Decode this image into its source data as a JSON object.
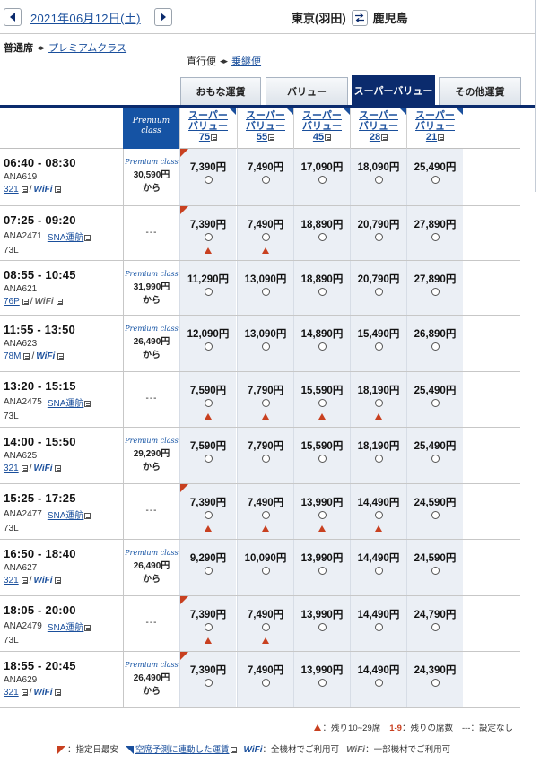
{
  "header": {
    "date": "2021年06月12日(土)",
    "origin": "東京(羽田)",
    "destination": "鹿児島"
  },
  "class_selector": {
    "current": "普通席",
    "other": "プレミアムクラス"
  },
  "direction_selector": {
    "current": "直行便",
    "other": "乗継便"
  },
  "tabs": [
    {
      "label": "おもな運賃",
      "active": false
    },
    {
      "label": "バリュー",
      "active": false
    },
    {
      "label": "スーパーバリュー",
      "active": true
    },
    {
      "label": "その他運賃",
      "active": false
    }
  ],
  "premium_header": "Premium class",
  "fare_columns": [
    {
      "line1": "スーパー",
      "line2": "バリュー",
      "days": "75"
    },
    {
      "line1": "スーパー",
      "line2": "バリュー",
      "days": "55"
    },
    {
      "line1": "スーパー",
      "line2": "バリュー",
      "days": "45"
    },
    {
      "line1": "スーパー",
      "line2": "バリュー",
      "days": "28"
    },
    {
      "line1": "スーパー",
      "line2": "バリュー",
      "days": "21"
    }
  ],
  "flights": [
    {
      "time": "06:40 - 08:30",
      "flight_no": "ANA619",
      "operator": "",
      "aircraft": "321",
      "aircraft_plain": "",
      "wifi": "WiFi",
      "premium_logo": "Premium class",
      "premium_price": "30,590円",
      "premium_from": "から",
      "fares": [
        {
          "price": "7,390円",
          "flag": true,
          "tri": false
        },
        {
          "price": "7,490円",
          "flag": false,
          "tri": false
        },
        {
          "price": "17,090円",
          "flag": false,
          "tri": false
        },
        {
          "price": "18,090円",
          "flag": false,
          "tri": false
        },
        {
          "price": "25,490円",
          "flag": false,
          "tri": false
        }
      ]
    },
    {
      "time": "07:25 - 09:20",
      "flight_no": "ANA2471",
      "operator": "SNA運航",
      "aircraft": "",
      "aircraft_plain": "73L",
      "wifi": "",
      "premium_logo": "",
      "premium_price": "",
      "premium_from": "",
      "dash": "---",
      "fares": [
        {
          "price": "7,390円",
          "flag": true,
          "tri": true
        },
        {
          "price": "7,490円",
          "flag": false,
          "tri": true
        },
        {
          "price": "18,890円",
          "flag": false,
          "tri": false
        },
        {
          "price": "20,790円",
          "flag": false,
          "tri": false
        },
        {
          "price": "27,890円",
          "flag": false,
          "tri": false
        }
      ]
    },
    {
      "time": "08:55 - 10:45",
      "flight_no": "ANA621",
      "operator": "",
      "aircraft": "76P",
      "aircraft_plain": "",
      "wifi": "WiFi",
      "wifi_part": true,
      "premium_logo": "Premium class",
      "premium_price": "31,990円",
      "premium_from": "から",
      "fares": [
        {
          "price": "11,290円",
          "flag": false,
          "tri": false
        },
        {
          "price": "13,090円",
          "flag": false,
          "tri": false
        },
        {
          "price": "18,890円",
          "flag": false,
          "tri": false
        },
        {
          "price": "20,790円",
          "flag": false,
          "tri": false
        },
        {
          "price": "27,890円",
          "flag": false,
          "tri": false
        }
      ]
    },
    {
      "time": "11:55 - 13:50",
      "flight_no": "ANA623",
      "operator": "",
      "aircraft": "78M",
      "aircraft_plain": "",
      "wifi": "WiFi",
      "premium_logo": "Premium class",
      "premium_price": "26,490円",
      "premium_from": "から",
      "fares": [
        {
          "price": "12,090円",
          "flag": false,
          "tri": false
        },
        {
          "price": "13,090円",
          "flag": false,
          "tri": false
        },
        {
          "price": "14,890円",
          "flag": false,
          "tri": false
        },
        {
          "price": "15,490円",
          "flag": false,
          "tri": false
        },
        {
          "price": "26,890円",
          "flag": false,
          "tri": false
        }
      ]
    },
    {
      "time": "13:20 - 15:15",
      "flight_no": "ANA2475",
      "operator": "SNA運航",
      "aircraft": "",
      "aircraft_plain": "73L",
      "wifi": "",
      "premium_logo": "",
      "premium_price": "",
      "premium_from": "",
      "dash": "---",
      "fares": [
        {
          "price": "7,590円",
          "flag": false,
          "tri": true
        },
        {
          "price": "7,790円",
          "flag": false,
          "tri": true
        },
        {
          "price": "15,590円",
          "flag": false,
          "tri": true
        },
        {
          "price": "18,190円",
          "flag": false,
          "tri": true
        },
        {
          "price": "25,490円",
          "flag": false,
          "tri": false
        }
      ]
    },
    {
      "time": "14:00 - 15:50",
      "flight_no": "ANA625",
      "operator": "",
      "aircraft": "321",
      "aircraft_plain": "",
      "wifi": "WiFi",
      "premium_logo": "Premium class",
      "premium_price": "29,290円",
      "premium_from": "から",
      "fares": [
        {
          "price": "7,590円",
          "flag": false,
          "tri": false
        },
        {
          "price": "7,790円",
          "flag": false,
          "tri": false
        },
        {
          "price": "15,590円",
          "flag": false,
          "tri": false
        },
        {
          "price": "18,190円",
          "flag": false,
          "tri": false
        },
        {
          "price": "25,490円",
          "flag": false,
          "tri": false
        }
      ]
    },
    {
      "time": "15:25 - 17:25",
      "flight_no": "ANA2477",
      "operator": "SNA運航",
      "aircraft": "",
      "aircraft_plain": "73L",
      "wifi": "",
      "premium_logo": "",
      "premium_price": "",
      "premium_from": "",
      "dash": "---",
      "fares": [
        {
          "price": "7,390円",
          "flag": true,
          "tri": true
        },
        {
          "price": "7,490円",
          "flag": false,
          "tri": true
        },
        {
          "price": "13,990円",
          "flag": false,
          "tri": true
        },
        {
          "price": "14,490円",
          "flag": false,
          "tri": true
        },
        {
          "price": "24,590円",
          "flag": false,
          "tri": false
        }
      ]
    },
    {
      "time": "16:50 - 18:40",
      "flight_no": "ANA627",
      "operator": "",
      "aircraft": "321",
      "aircraft_plain": "",
      "wifi": "WiFi",
      "premium_logo": "Premium class",
      "premium_price": "26,490円",
      "premium_from": "から",
      "fares": [
        {
          "price": "9,290円",
          "flag": false,
          "tri": false
        },
        {
          "price": "10,090円",
          "flag": false,
          "tri": false
        },
        {
          "price": "13,990円",
          "flag": false,
          "tri": false
        },
        {
          "price": "14,490円",
          "flag": false,
          "tri": false
        },
        {
          "price": "24,590円",
          "flag": false,
          "tri": false
        }
      ]
    },
    {
      "time": "18:05 - 20:00",
      "flight_no": "ANA2479",
      "operator": "SNA運航",
      "aircraft": "",
      "aircraft_plain": "73L",
      "wifi": "",
      "premium_logo": "",
      "premium_price": "",
      "premium_from": "",
      "dash": "---",
      "fares": [
        {
          "price": "7,390円",
          "flag": true,
          "tri": true
        },
        {
          "price": "7,490円",
          "flag": false,
          "tri": true
        },
        {
          "price": "13,990円",
          "flag": false,
          "tri": false
        },
        {
          "price": "14,490円",
          "flag": false,
          "tri": false
        },
        {
          "price": "24,790円",
          "flag": false,
          "tri": false
        }
      ]
    },
    {
      "time": "18:55 - 20:45",
      "flight_no": "ANA629",
      "operator": "",
      "aircraft": "321",
      "aircraft_plain": "",
      "wifi": "WiFi",
      "premium_logo": "Premium class",
      "premium_price": "26,490円",
      "premium_from": "から",
      "fares": [
        {
          "price": "7,390円",
          "flag": true,
          "tri": false
        },
        {
          "price": "7,490円",
          "flag": false,
          "tri": false
        },
        {
          "price": "13,990円",
          "flag": false,
          "tri": false
        },
        {
          "price": "14,490円",
          "flag": false,
          "tri": false
        },
        {
          "price": "24,390円",
          "flag": false,
          "tri": false
        }
      ]
    }
  ],
  "legend": {
    "tri_text": "：残り10~29席",
    "count_mark": "1-9",
    "count_text": "：残りの席数",
    "dash_mark": "---",
    "dash_text": "：設定なし",
    "flag_text": "：指定日最安",
    "linked_link": "空席予測に連動した運賃",
    "wifi_all_mark": "WiFi",
    "wifi_all_text": "：全機材でご利用可",
    "wifi_part_mark": "WiFi",
    "wifi_part_text": "：一部機材でご利用可"
  },
  "colors": {
    "brand": "#0b2b6d",
    "link": "#1a4f9c",
    "premium": "#1553a4",
    "alert": "#c84020"
  }
}
